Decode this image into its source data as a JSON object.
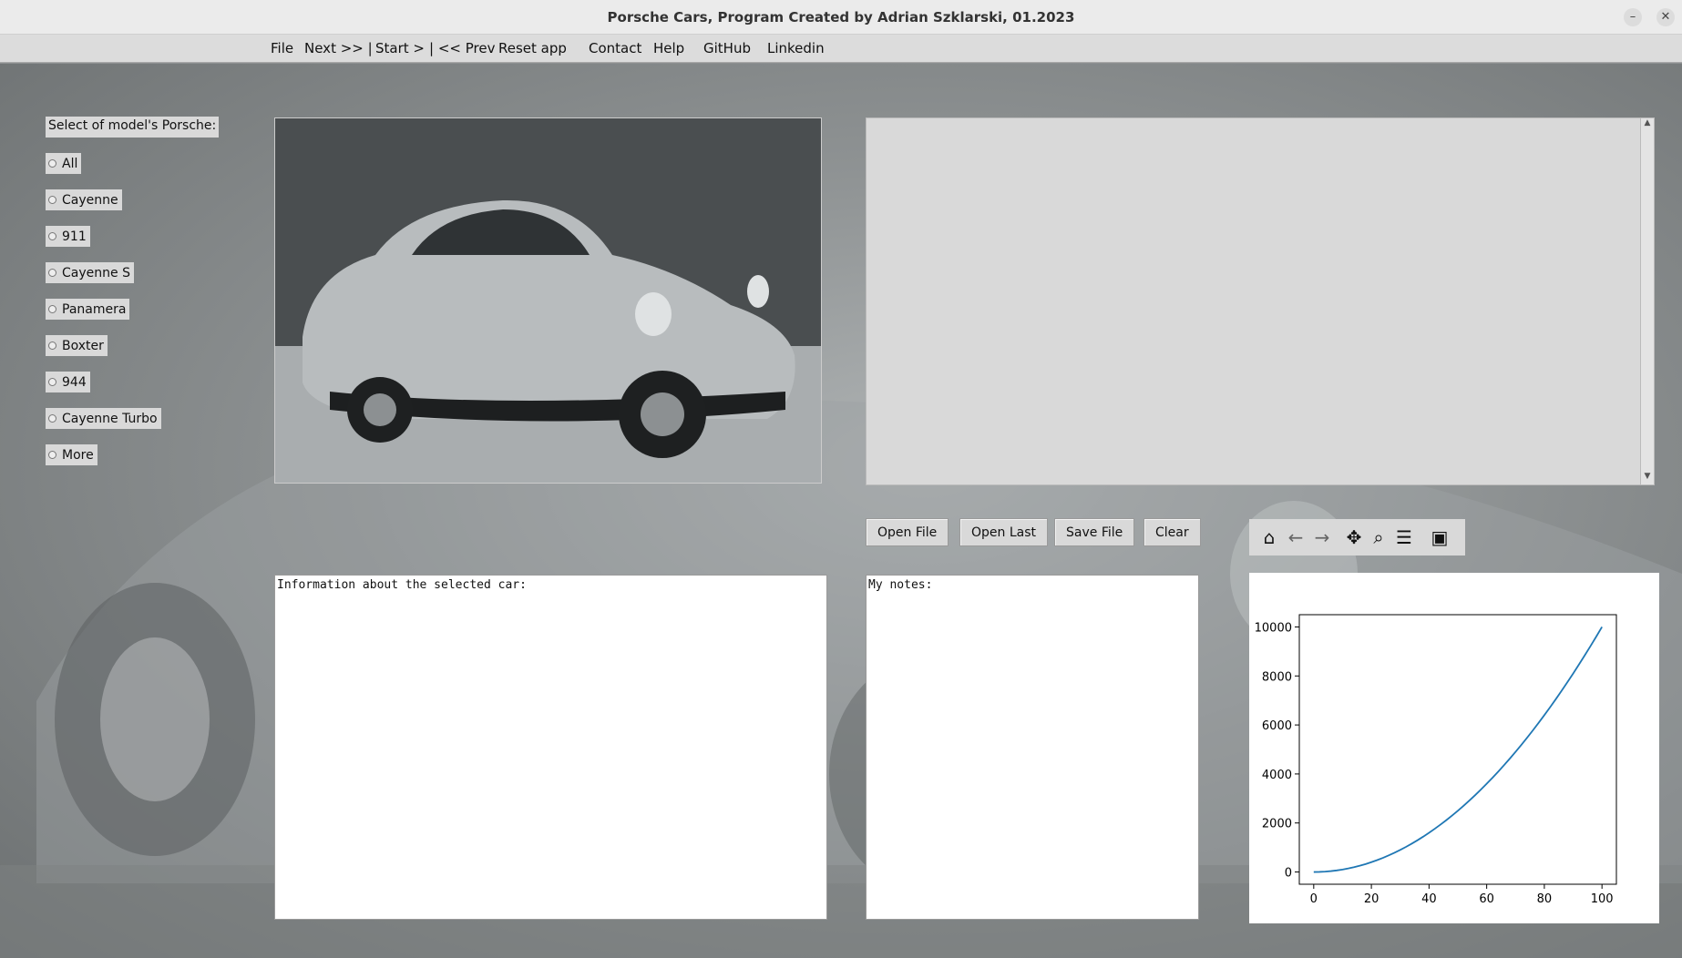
{
  "window": {
    "title": "Porsche Cars, Program Created by Adrian Szklarski, 01.2023"
  },
  "menu": {
    "file": "File",
    "next": "Next >> |",
    "start": "Start >",
    "prev": "| << Prev",
    "reset": "Reset app",
    "contact": "Contact",
    "help": "Help",
    "github": "GitHub",
    "linkedin": "Linkedin"
  },
  "model_select": {
    "label": "Select of model's Porsche:",
    "options": [
      "All",
      "Cayenne",
      "911",
      "Cayenne S",
      "Panamera",
      "Boxter",
      "944",
      "Cayenne Turbo",
      "More"
    ]
  },
  "buttons": {
    "open_file": "Open File",
    "open_last": "Open Last",
    "save_file": "Save File",
    "clear": "Clear"
  },
  "plot_toolbar": [
    "home-icon",
    "back-icon",
    "forward-icon",
    "pan-icon",
    "zoom-icon",
    "configure-icon",
    "save-icon"
  ],
  "info_box": {
    "text": "Information about the selected car:"
  },
  "notes_box": {
    "text": "My notes:"
  },
  "chart_data": {
    "type": "line",
    "title": "",
    "xlabel": "",
    "ylabel": "",
    "x": [
      0,
      10,
      20,
      30,
      40,
      50,
      60,
      70,
      80,
      90,
      100
    ],
    "series": [
      {
        "values": [
          0,
          100,
          400,
          900,
          1600,
          2500,
          3600,
          4900,
          6400,
          8100,
          10000
        ]
      }
    ],
    "xlim": [
      -5,
      105
    ],
    "ylim": [
      -500,
      10500
    ],
    "xticks": [
      0,
      20,
      40,
      60,
      80,
      100
    ],
    "yticks": [
      0,
      2000,
      4000,
      6000,
      8000,
      10000
    ],
    "grid": false,
    "line_color": "#1f77b4"
  }
}
